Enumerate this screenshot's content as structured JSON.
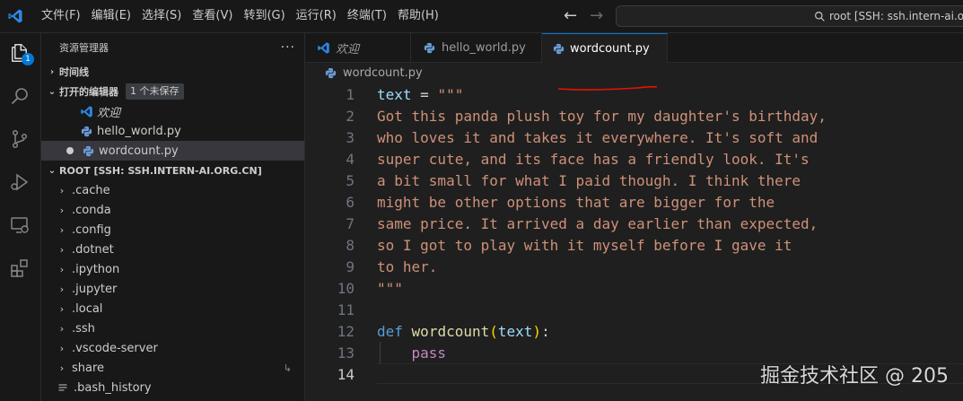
{
  "menu": [
    "文件(F)",
    "编辑(E)",
    "选择(S)",
    "查看(V)",
    "转到(G)",
    "运行(R)",
    "终端(T)",
    "帮助(H)"
  ],
  "command_center": {
    "text": "root [SSH: ssh.intern-ai.org.cn"
  },
  "activity_bar": {
    "explorer_badge": "1"
  },
  "sidebar": {
    "title": "资源管理器",
    "timeline": "时间线",
    "open_editors": {
      "label": "打开的编辑器",
      "badge": "1 个未保存",
      "items": [
        "欢迎",
        "hello_world.py",
        "wordcount.py"
      ]
    },
    "root": {
      "label": "ROOT [SSH: SSH.INTERN-AI.ORG.CN]",
      "folders": [
        ".cache",
        ".conda",
        ".config",
        ".dotnet",
        ".ipython",
        ".jupyter",
        ".local",
        ".ssh",
        ".vscode-server",
        "share"
      ],
      "files": [
        ".bash_history"
      ]
    }
  },
  "tabs": [
    {
      "label": "欢迎"
    },
    {
      "label": "hello_world.py"
    },
    {
      "label": "wordcount.py"
    }
  ],
  "breadcrumb": "wordcount.py",
  "code": {
    "line_numbers": [
      "1",
      "2",
      "3",
      "4",
      "5",
      "6",
      "7",
      "8",
      "9",
      "10",
      "11",
      "12",
      "13",
      "14"
    ],
    "l1_var": "text",
    "l1_op": " = ",
    "l1_str": "\"\"\"",
    "l2": "Got this panda plush toy for my daughter's birthday,",
    "l3": "who loves it and takes it everywhere. It's soft and",
    "l4": "super cute, and its face has a friendly look. It's",
    "l5": "a bit small for what I paid though. I think there",
    "l6": "might be other options that are bigger for the",
    "l7": "same price. It arrived a day earlier than expected,",
    "l8": "so I got to play with it myself before I gave it",
    "l9": "to her.",
    "l10": "\"\"\"",
    "l12_kw": "def",
    "l12_fn": "wordcount",
    "l12_lparen": "(",
    "l12_param": "text",
    "l12_rparen": ")",
    "l12_colon": ":",
    "l13_indent": "    ",
    "l13": "pass"
  },
  "watermark": "掘金技术社区 @ 205",
  "colors": {
    "accent": "#0078d4",
    "string": "#ce9178",
    "keyword": "#569cd6",
    "function": "#dcdcaa",
    "annotation": "#e51400"
  }
}
